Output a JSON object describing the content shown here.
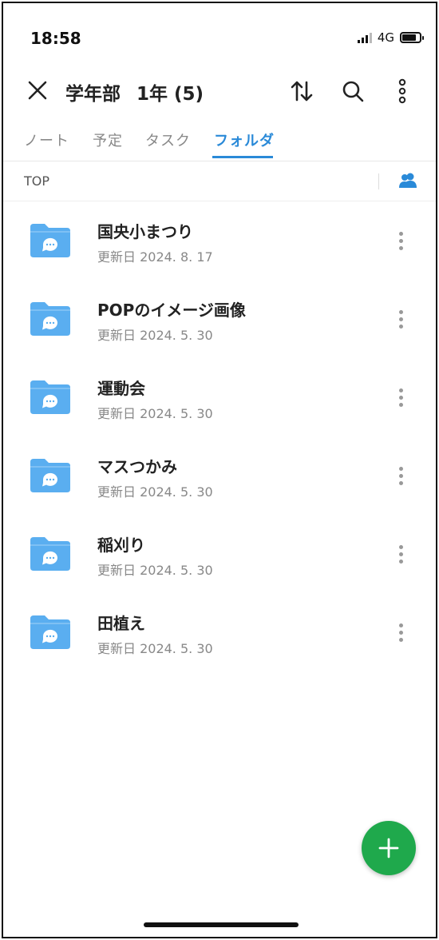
{
  "status_bar": {
    "time": "18:58",
    "network": "4G"
  },
  "header": {
    "title_group": "学年部",
    "title_grade": "1年 (5)"
  },
  "tabs": [
    {
      "label": "ノート",
      "active": false
    },
    {
      "label": "予定",
      "active": false
    },
    {
      "label": "タスク",
      "active": false
    },
    {
      "label": "フォルダ",
      "active": true
    }
  ],
  "breadcrumb": "TOP",
  "folders": [
    {
      "name": "国央小まつり",
      "updated": "更新日 2024. 8. 17"
    },
    {
      "name": "POPのイメージ画像",
      "updated": "更新日 2024. 5. 30"
    },
    {
      "name": "運動会",
      "updated": "更新日 2024. 5. 30"
    },
    {
      "name": "マスつかみ",
      "updated": "更新日 2024. 5. 30"
    },
    {
      "name": "稲刈り",
      "updated": "更新日 2024. 5. 30"
    },
    {
      "name": "田植え",
      "updated": "更新日 2024. 5. 30"
    }
  ],
  "colors": {
    "accent": "#2a8ad8",
    "folder": "#5aaef0",
    "fab": "#1fa94c"
  },
  "icons": {
    "close": "close-icon",
    "sort": "sort-icon",
    "search": "search-icon",
    "more": "more-vertical-icon",
    "members": "members-icon",
    "folder": "folder-chat-icon",
    "add": "plus-icon"
  }
}
